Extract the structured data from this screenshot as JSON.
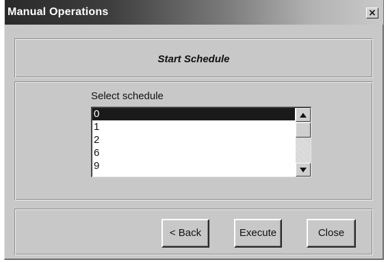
{
  "window": {
    "title": "Manual Operations",
    "close_glyph": "×"
  },
  "header": {
    "title": "Start Schedule"
  },
  "schedule_select": {
    "label": "Select schedule",
    "items": [
      "0",
      "1",
      "2",
      "6",
      "9"
    ],
    "selected_index": 0
  },
  "scrollbar": {
    "up_icon": "arrow-up-icon",
    "down_icon": "arrow-down-icon"
  },
  "buttons": {
    "back_label": "< Back",
    "execute_label": "Execute",
    "close_label": "Close"
  },
  "colors": {
    "dialog_bg": "#c8c8c8",
    "selection_bg": "#1a1a1a",
    "selection_text": "#ffffff"
  }
}
